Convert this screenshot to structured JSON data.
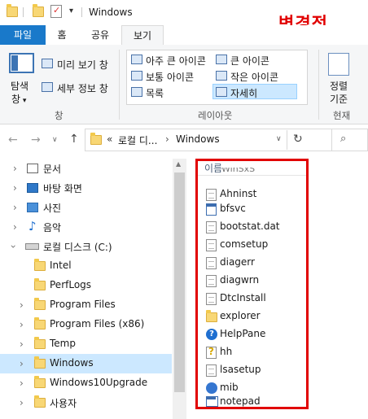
{
  "window": {
    "title": "Windows"
  },
  "annotation": {
    "label": "변경전",
    "color": "#e10000"
  },
  "ribbon_tabs": [
    {
      "label": "파일"
    },
    {
      "label": "홈"
    },
    {
      "label": "공유"
    },
    {
      "label": "보기"
    }
  ],
  "ribbon": {
    "pane_group": {
      "nav_pane": "탐색",
      "nav_pane2": "창",
      "preview": "미리 보기 창",
      "details": "세부 정보 창",
      "label": "창"
    },
    "layout_group": {
      "options": [
        {
          "label": "아주 큰 아이콘"
        },
        {
          "label": "큰 아이콘"
        },
        {
          "label": "보통 아이콘"
        },
        {
          "label": "작은 아이콘"
        },
        {
          "label": "목록"
        },
        {
          "label": "자세히"
        }
      ],
      "selected": "자세히",
      "label": "레이아웃"
    },
    "sort_group": {
      "sort": "정렬",
      "sort2": "기준",
      "current": "현재"
    }
  },
  "address": {
    "overflow": "«",
    "crumbs": [
      "로컬 디...",
      "Windows"
    ],
    "chevron": "›"
  },
  "nav_tree": [
    {
      "label": "문서",
      "icon": "documents-icon",
      "indent": 0
    },
    {
      "label": "바탕 화면",
      "icon": "desktop-icon",
      "indent": 0
    },
    {
      "label": "사진",
      "icon": "pictures-icon",
      "indent": 0
    },
    {
      "label": "음악",
      "icon": "music-icon",
      "indent": 0
    },
    {
      "label": "로컬 디스크 (C:)",
      "icon": "drive-icon",
      "indent": 0,
      "expanded": true
    },
    {
      "label": "Intel",
      "icon": "folder-icon",
      "indent": 1
    },
    {
      "label": "PerfLogs",
      "icon": "folder-icon",
      "indent": 1
    },
    {
      "label": "Program Files",
      "icon": "folder-icon",
      "indent": 1
    },
    {
      "label": "Program Files (x86)",
      "icon": "folder-icon",
      "indent": 1
    },
    {
      "label": "Temp",
      "icon": "folder-icon",
      "indent": 1
    },
    {
      "label": "Windows",
      "icon": "folder-icon",
      "indent": 1,
      "selected": true
    },
    {
      "label": "Windows10Upgrade",
      "icon": "folder-icon",
      "indent": 1
    },
    {
      "label": "사용자",
      "icon": "folder-icon",
      "indent": 1
    }
  ],
  "file_list": {
    "column": "이름",
    "partial_top": "WinSxS",
    "files": [
      {
        "name": "Ahninst",
        "icon": "document-icon"
      },
      {
        "name": "bfsvc",
        "icon": "application-icon"
      },
      {
        "name": "bootstat.dat",
        "icon": "document-icon"
      },
      {
        "name": "comsetup",
        "icon": "document-icon"
      },
      {
        "name": "diagerr",
        "icon": "document-icon"
      },
      {
        "name": "diagwrn",
        "icon": "document-icon"
      },
      {
        "name": "DtcInstall",
        "icon": "document-icon"
      },
      {
        "name": "explorer",
        "icon": "explorer-icon"
      },
      {
        "name": "HelpPane",
        "icon": "help-icon"
      },
      {
        "name": "hh",
        "icon": "help-file-icon"
      },
      {
        "name": "lsasetup",
        "icon": "document-icon"
      },
      {
        "name": "mib",
        "icon": "mib-icon"
      },
      {
        "name": "notepad",
        "icon": "notepad-icon"
      }
    ]
  }
}
